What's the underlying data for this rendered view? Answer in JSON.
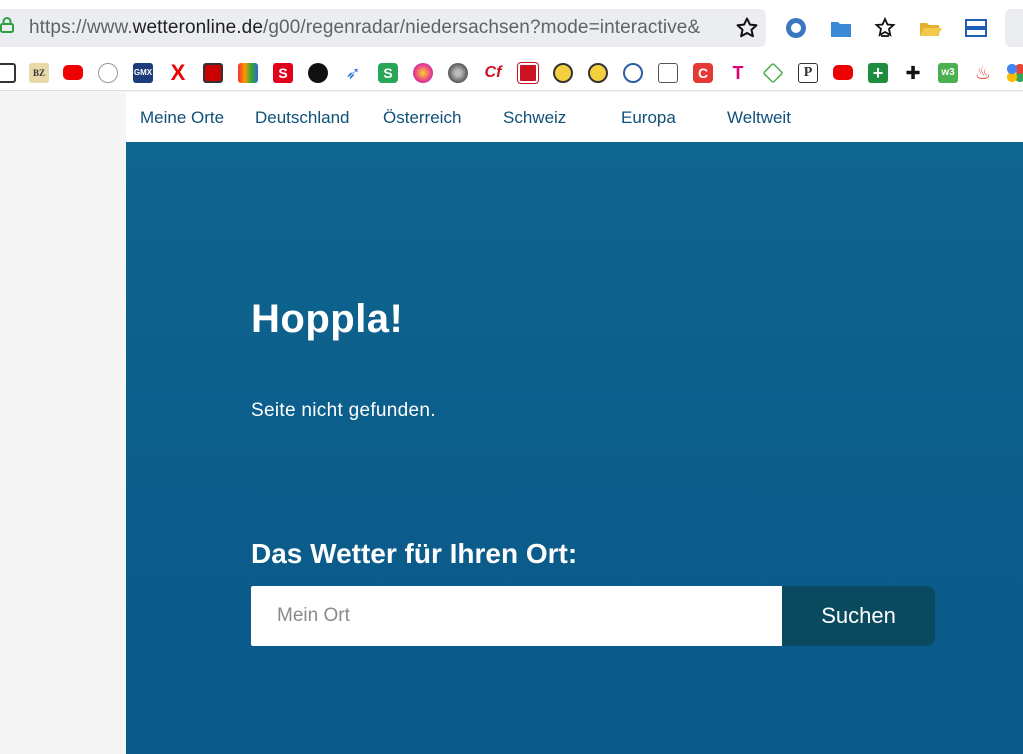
{
  "browser": {
    "url_prefix": "https://www.",
    "url_host": "wetteronline.de",
    "url_path": "/g00/regenradar/niedersachsen?mode=interactive&"
  },
  "colors": {
    "hero_bg": "#0b5c8a",
    "nav_text": "#10507a",
    "button_bg": "#0a4a5e"
  },
  "nav": {
    "items": [
      "Meine Orte",
      "Deutschland",
      "Österreich",
      "Schweiz",
      "Europa",
      "Weltweit"
    ]
  },
  "error": {
    "title": "Hoppla!",
    "message": "Seite nicht gefunden."
  },
  "search": {
    "heading": "Das Wetter für Ihren Ort:",
    "placeholder": "Mein Ort",
    "button_label": "Suchen"
  },
  "bookmarks": [
    "folder-icon",
    "bz-icon",
    "youtube-icon",
    "wiki-icon",
    "gmx-icon",
    "x-icon",
    "calendar-icon",
    "shop-icon",
    "sparkasse-icon",
    "github-icon",
    "rocket-icon",
    "s-app-icon",
    "firefox-icon",
    "disk-icon",
    "cf-icon",
    "ref-icon",
    "smiley-icon",
    "smiley2-icon",
    "web-icon",
    "edit-icon",
    "c-icon",
    "telekom-icon",
    "diamond-icon",
    "p-icon",
    "youtube2-icon",
    "plus-icon",
    "puzzle-icon",
    "w3-icon",
    "fire-icon",
    "dots-icon"
  ]
}
